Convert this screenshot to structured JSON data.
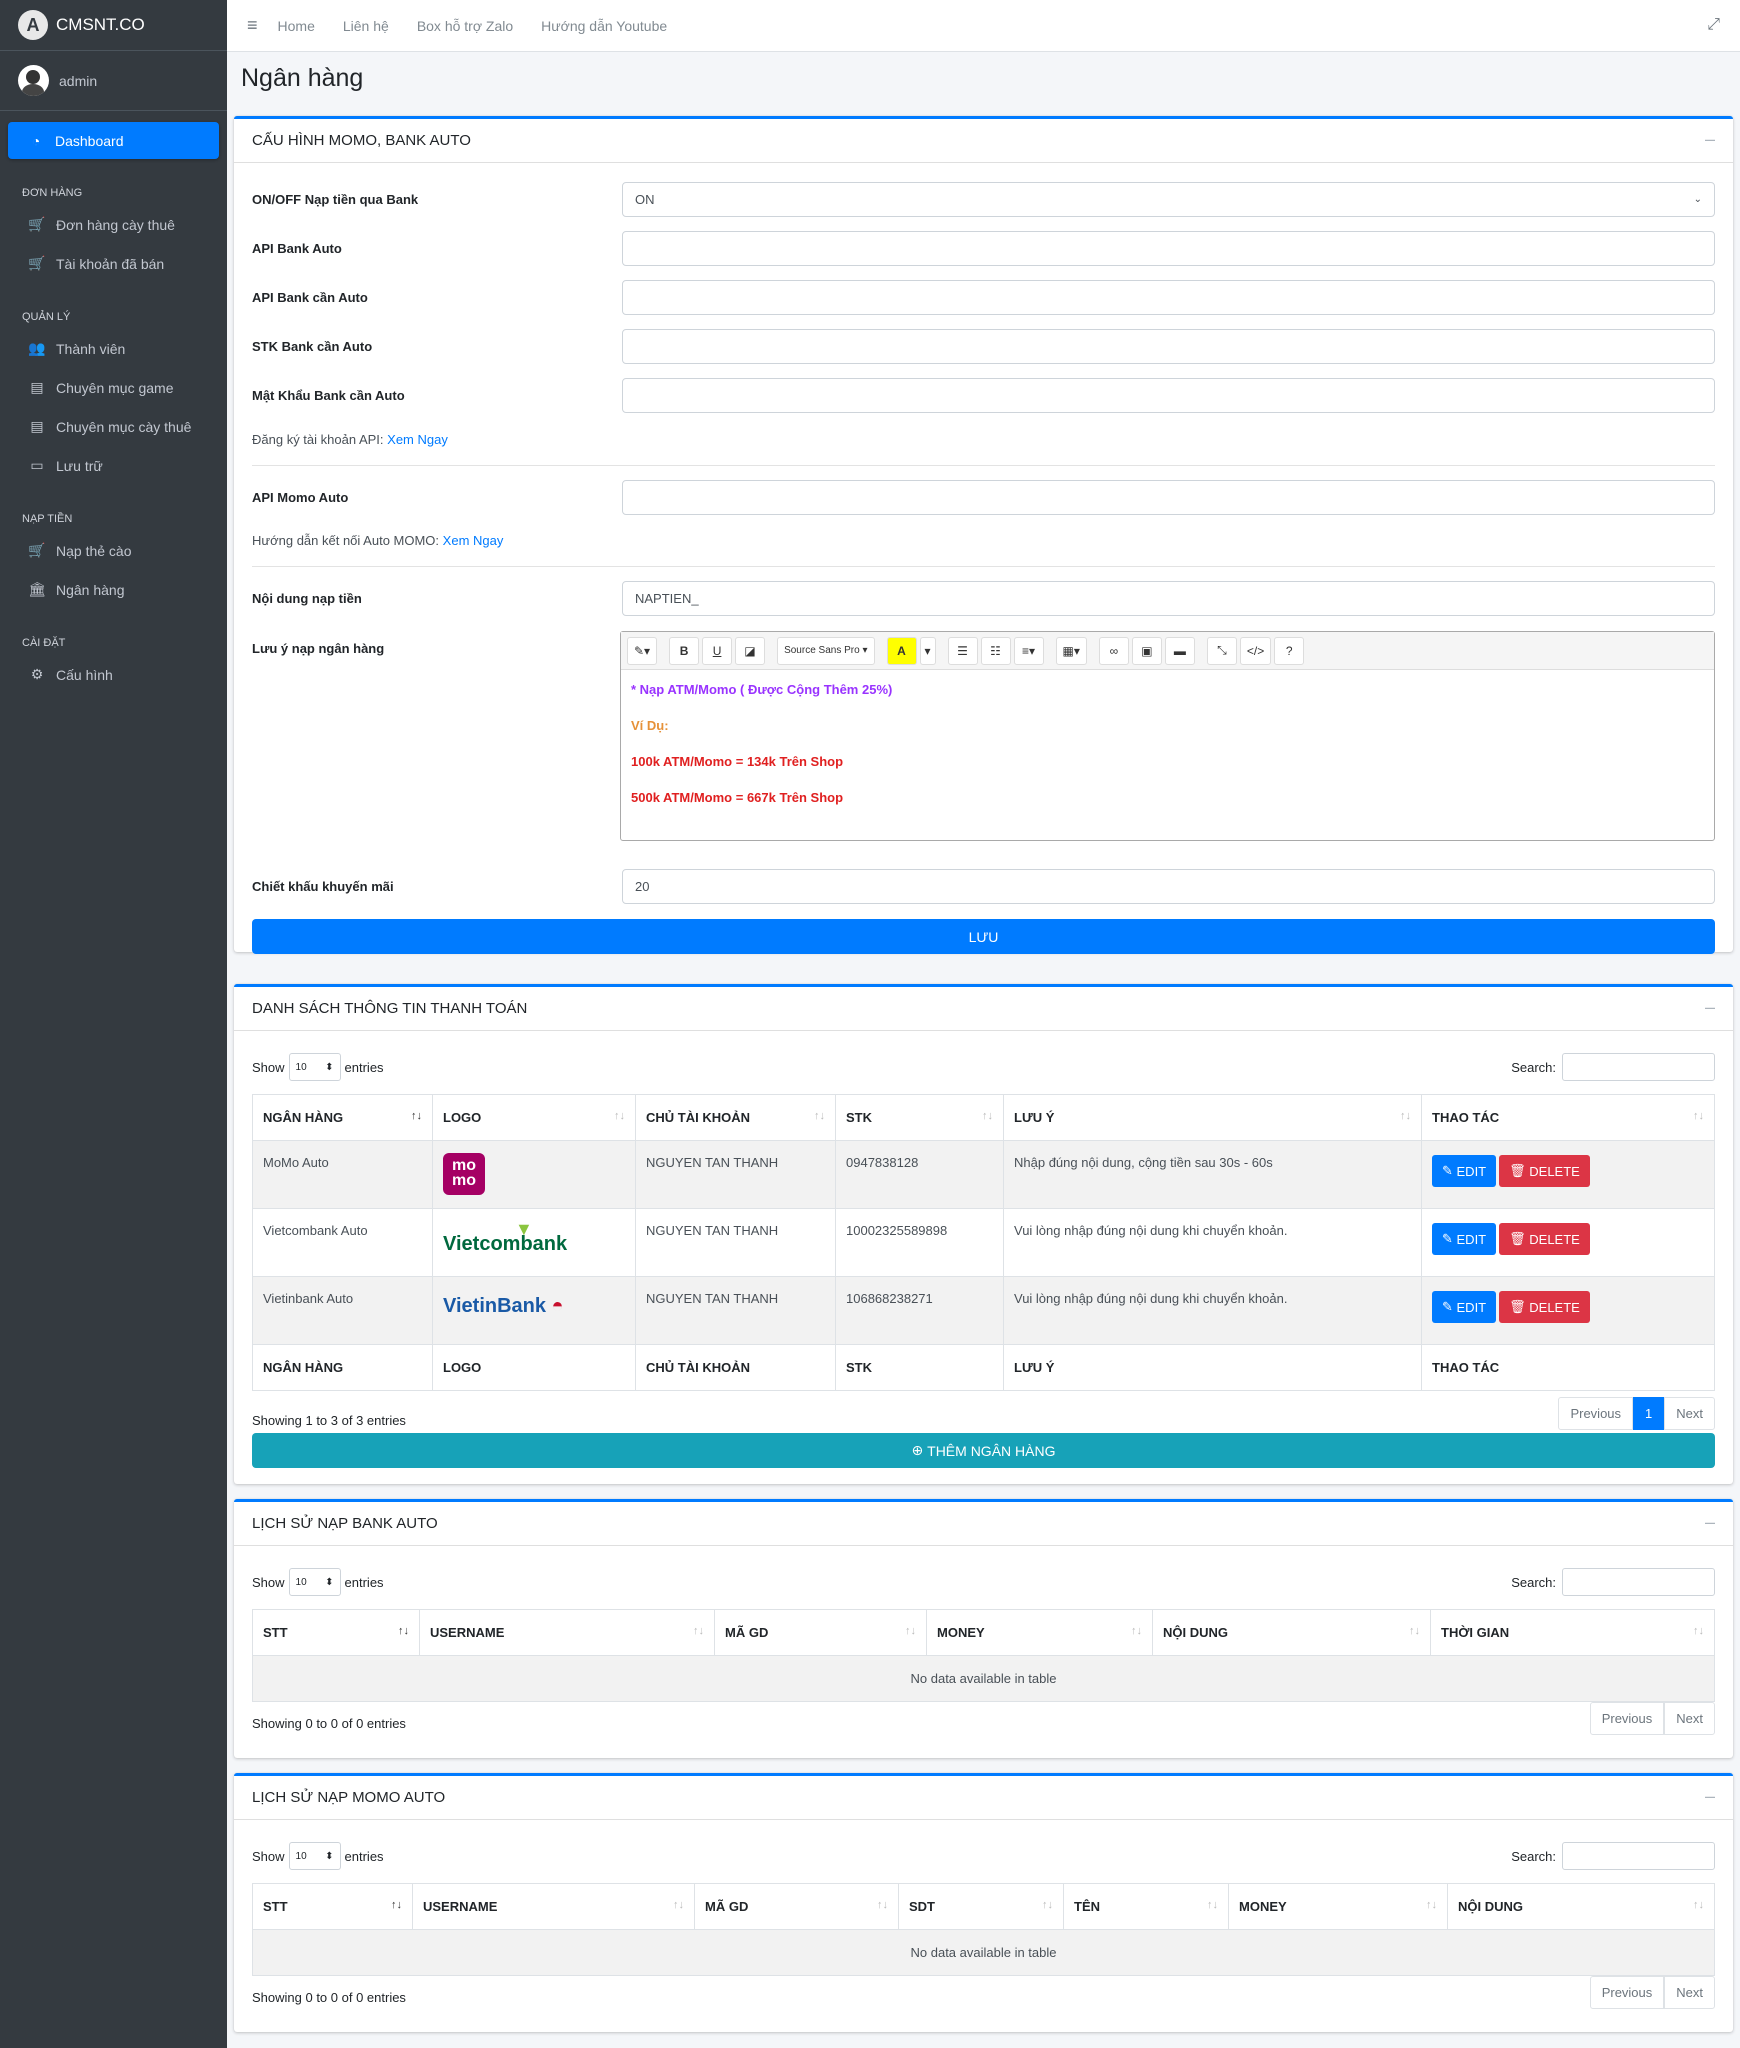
{
  "brand": {
    "name": "CMSNT.CO",
    "logo_letter": "A"
  },
  "user": {
    "name": "admin"
  },
  "sidebar": {
    "active": "Dashboard",
    "sections": [
      {
        "header": "ĐƠN HÀNG",
        "items": [
          {
            "label": "Đơn hàng cày thuê",
            "icon": "cart-icon"
          },
          {
            "label": "Tài khoản đã bán",
            "icon": "cart-icon"
          }
        ]
      },
      {
        "header": "QUẢN LÝ",
        "items": [
          {
            "label": "Thành viên",
            "icon": "users-icon"
          },
          {
            "label": "Chuyên mục game",
            "icon": "file-icon"
          },
          {
            "label": "Chuyên mục cày thuê",
            "icon": "file-icon"
          },
          {
            "label": "Lưu trữ",
            "icon": "archive-icon"
          }
        ]
      },
      {
        "header": "NẠP TIỀN",
        "items": [
          {
            "label": "Nạp thẻ cào",
            "icon": "cart-icon"
          },
          {
            "label": "Ngân hàng",
            "icon": "bank-icon"
          }
        ]
      },
      {
        "header": "CÀI ĐẶT",
        "items": [
          {
            "label": "Cấu hình",
            "icon": "gear-icon"
          }
        ]
      }
    ]
  },
  "navbar": {
    "links": [
      "Home",
      "Liên hệ",
      "Box hỗ trợ Zalo",
      "Hướng dẫn Youtube"
    ]
  },
  "page_title": "Ngân hàng",
  "config": {
    "title": "CẤU HÌNH MOMO, BANK AUTO",
    "bank_toggle_label": "ON/OFF Nạp tiền qua Bank",
    "bank_toggle_value": "ON",
    "api_bank_label": "API Bank Auto",
    "api_bank_can_label": "API Bank cần Auto",
    "stk_label": "STK Bank cần Auto",
    "password_label": "Mật Khẩu Bank cần Auto",
    "register_text": "Đăng ký tài khoản API:",
    "register_link": "Xem Ngay",
    "api_momo_label": "API Momo Auto",
    "momo_guide_text": "Hướng dẫn kết nối Auto MOMO:",
    "momo_guide_link": "Xem Ngay",
    "content_label": "Nội dung nạp tiền",
    "content_value": "NAPTIEN_",
    "note_label": "Lưu ý nạp ngân hàng",
    "editor_font": "Source Sans Pro",
    "editor_lines": [
      "* Nạp ATM/Momo ( Được Cộng Thêm 25%)",
      "Ví Dụ:",
      "100k ATM/Momo = 134k Trên Shop",
      "500k ATM/Momo = 667k Trên Shop"
    ],
    "discount_label": "Chiết khấu khuyến mãi",
    "discount_value": "20",
    "save_label": "LƯU"
  },
  "payment_list": {
    "title": "DANH SÁCH THÔNG TIN THANH TOÁN",
    "show": "Show",
    "entries": "entries",
    "page_size": "10",
    "search": "Search:",
    "columns": [
      "NGÂN HÀNG",
      "LOGO",
      "CHỦ TÀI KHOẢN",
      "STK",
      "LƯU Ý",
      "THAO TÁC"
    ],
    "rows": [
      {
        "bank": "MoMo Auto",
        "logo": "momo",
        "owner": "NGUYEN TAN THANH",
        "stk": "0947838128",
        "note": "Nhập đúng nội dung, cộng tiền sau 30s - 60s"
      },
      {
        "bank": "Vietcombank Auto",
        "logo": "Vietcombank",
        "owner": "NGUYEN TAN THANH",
        "stk": "10002325589898",
        "note": "Vui lòng nhập đúng nội dung khi chuyển khoản."
      },
      {
        "bank": "Vietinbank Auto",
        "logo": "VietinBank",
        "owner": "NGUYEN TAN THANH",
        "stk": "106868238271",
        "note": "Vui lòng nhập đúng nội dung khi chuyển khoản."
      }
    ],
    "edit_label": "EDIT",
    "delete_label": "DELETE",
    "info": "Showing 1 to 3 of 3 entries",
    "prev": "Previous",
    "page": "1",
    "next": "Next",
    "add_label": "THÊM NGÂN HÀNG"
  },
  "bank_history": {
    "title": "LỊCH SỬ NẠP BANK AUTO",
    "show": "Show",
    "entries": "entries",
    "page_size": "10",
    "search": "Search:",
    "columns": [
      "STT",
      "USERNAME",
      "MÃ GD",
      "MONEY",
      "NỘI DUNG",
      "THỜI GIAN"
    ],
    "empty": "No data available in table",
    "info": "Showing 0 to 0 of 0 entries",
    "prev": "Previous",
    "next": "Next"
  },
  "momo_history": {
    "title": "LỊCH SỬ NẠP MOMO AUTO",
    "show": "Show",
    "entries": "entries",
    "page_size": "10",
    "search": "Search:",
    "columns": [
      "STT",
      "USERNAME",
      "MÃ GD",
      "SDT",
      "TÊN",
      "MONEY",
      "NỘI DUNG"
    ],
    "empty": "No data available in table",
    "info": "Showing 0 to 0 of 0 entries",
    "prev": "Previous",
    "next": "Next"
  }
}
